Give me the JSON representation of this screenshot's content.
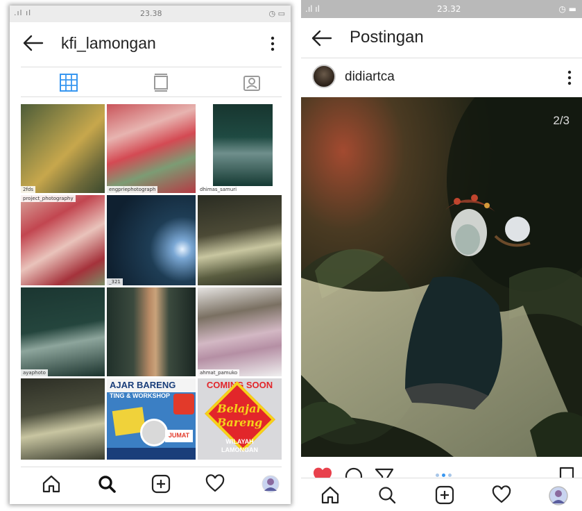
{
  "left": {
    "status": {
      "signal": ".ıl ıl",
      "time": "23.38",
      "right": "◷ ▭"
    },
    "header": {
      "title": "kfi_lamongan"
    },
    "grid_tags": [
      "2fds",
      "project_photography",
      "engpriephotograph",
      "dhimas_samuri",
      "_321",
      "ayaphoto",
      "ahmat_pamuko"
    ],
    "posters": {
      "left_title": "AJAR BARENG",
      "left_sub": "TING & WORKSHOP",
      "left_date": "JUMAT",
      "right_top": "COMING SOON",
      "right_main_1": "Belajar",
      "right_main_2": "Bareng",
      "right_footer_1": "WILAYAH",
      "right_footer_2": "LAMONGAN"
    }
  },
  "right": {
    "status": {
      "signal": ".ıl ıl",
      "time": "23.32",
      "right": "◷ ▬"
    },
    "header": {
      "title": "Postingan"
    },
    "post": {
      "username": "didiartca",
      "counter": "2/3"
    }
  },
  "icons": [
    "back-arrow-icon",
    "more-vertical-icon",
    "grid-icon",
    "feed-icon",
    "tagged-icon",
    "home-icon",
    "search-icon",
    "add-icon",
    "heart-icon",
    "profile-icon",
    "comment-icon",
    "share-icon",
    "bookmark-icon"
  ],
  "colors": {
    "like": "#e8414c",
    "grid_active": "#3897f0",
    "text": "#222222"
  }
}
